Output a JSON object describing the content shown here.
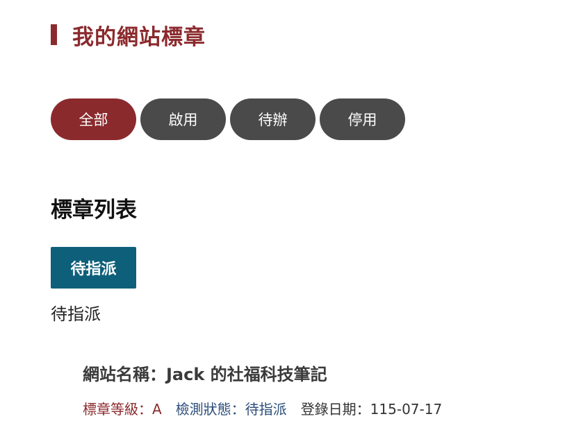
{
  "page": {
    "title": "我的網站標章"
  },
  "filters": {
    "tabs": [
      {
        "label": "全部",
        "active": true
      },
      {
        "label": "啟用",
        "active": false
      },
      {
        "label": "待辦",
        "active": false
      },
      {
        "label": "停用",
        "active": false
      }
    ]
  },
  "list": {
    "title": "標章列表",
    "status_button_label": "待指派",
    "status_caption": "待指派"
  },
  "site": {
    "name": "網站名稱：Jack 的社福科技筆記",
    "level": "標章等級：A",
    "check_status": "檢測狀態：待指派",
    "register_date": "登錄日期：115-07-17"
  },
  "colors": {
    "accent": "#8b2a2d",
    "tab_inactive": "#4a4a4a",
    "status_button": "#0e5f7a",
    "check_status_text": "#2b4d7a"
  }
}
